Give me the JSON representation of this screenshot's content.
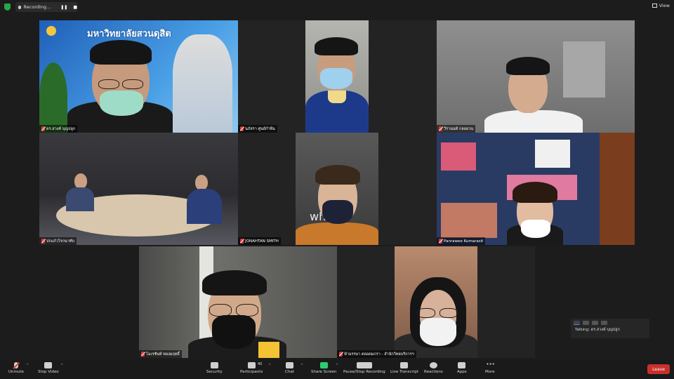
{
  "topbar": {
    "recording_label": "Recording...",
    "view_label": "View"
  },
  "tiles": [
    {
      "name": "ดร.สวงค์ บุญปลูก",
      "banner": "มหาวิทยาลัยสวนดุสิต"
    },
    {
      "name": "นภัสรา ศูนย์กำพืน"
    },
    {
      "name": "วีรานนท์ กลอยวน"
    },
    {
      "name": "ปกแก้วโรกนาทับ"
    },
    {
      "name": "JONAHTAN SMITH",
      "shirt_text": "wh"
    },
    {
      "name": "Panrawee Kumarasit"
    },
    {
      "name": "โมเรซันท์ ทองมฤทธิ์"
    },
    {
      "name": "ฟ้ามรรษา ตลอดมกรา - สำนักวิทยบริการฯ"
    }
  ],
  "talking": {
    "label": "Talking: ดร.สวงค์ บุญปลูก"
  },
  "toolbar": {
    "unmute": "Unmute",
    "stop_video": "Stop Video",
    "security": "Security",
    "participants": "Participants",
    "participants_count": "40",
    "chat": "Chat",
    "share_screen": "Share Screen",
    "pause_recording": "Pause/Stop Recording",
    "live_transcript": "Live Transcript",
    "reactions": "Reactions",
    "apps": "Apps",
    "more": "More",
    "leave": "Leave"
  },
  "colors": {
    "active_speaker": "#f2e44a",
    "leave": "#c9302c",
    "share": "#2ecc71",
    "accent": "#2d8cff"
  }
}
